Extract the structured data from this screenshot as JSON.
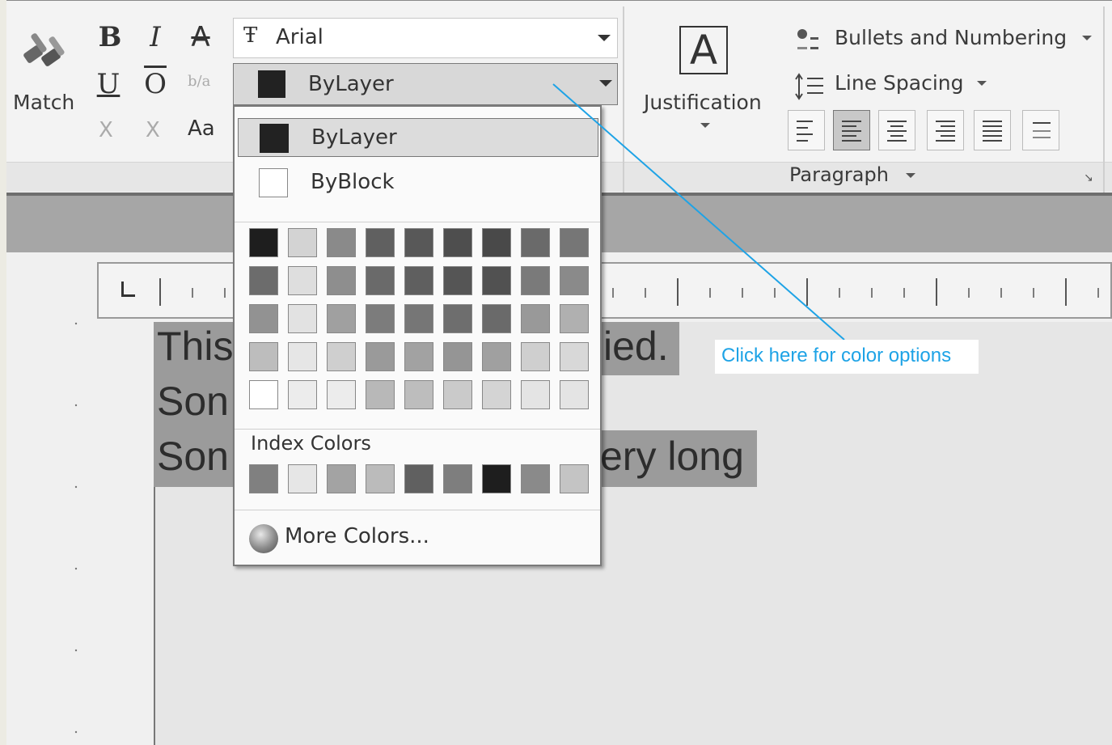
{
  "ribbon": {
    "match_label": "Match",
    "bold": "B",
    "italic": "I",
    "strike": "A",
    "underline": "U",
    "overline": "O",
    "stack": "b/a",
    "superscript": "X",
    "subscript": "X",
    "case": "Aa",
    "font_value": "Arial",
    "color_value": "ByLayer",
    "justification_label": "Justification",
    "bullets_label": "Bullets and Numbering",
    "line_spacing_label": "Line Spacing",
    "paragraph_label": "Paragraph"
  },
  "color_dropdown": {
    "items": [
      {
        "label": "ByLayer",
        "color": "#222222",
        "selected": true
      },
      {
        "label": "ByBlock",
        "color": "#ffffff",
        "selected": false
      }
    ],
    "palette": [
      [
        "#1e1e1e",
        "#d3d3d3",
        "#8a8a8a",
        "#606060",
        "#585858",
        "#4e4e4e",
        "#494949",
        "#6a6a6a",
        "#767676"
      ],
      [
        "#6c6c6c",
        "#dedede",
        "#8e8e8e",
        "#6a6a6a",
        "#5f5f5f",
        "#555555",
        "#515151",
        "#7a7a7a",
        "#8a8a8a"
      ],
      [
        "#929292",
        "#e2e2e2",
        "#a0a0a0",
        "#7c7c7c",
        "#767676",
        "#6e6e6e",
        "#6a6a6a",
        "#999999",
        "#b0b0b0"
      ],
      [
        "#bdbdbd",
        "#e6e6e6",
        "#cfcfcf",
        "#9a9a9a",
        "#a2a2a2",
        "#959595",
        "#a0a0a0",
        "#cfcfcf",
        "#d8d8d8"
      ],
      [
        "#ffffff",
        "#ececec",
        "#ececec",
        "#b8b8b8",
        "#bdbdbd",
        "#cacaca",
        "#d4d4d4",
        "#e4e4e4",
        "#e4e4e4"
      ]
    ],
    "index_colors_label": "Index Colors",
    "index_colors": [
      "#808080",
      "#e6e6e6",
      "#a3a3a3",
      "#bbbbbb",
      "#606060",
      "#7e7e7e",
      "#1e1e1e",
      "#8a8a8a",
      "#c4c4c4"
    ],
    "more_colors_label": "More Colors..."
  },
  "document": {
    "line1_left": "This",
    "line1_right": "ied.",
    "line2_left": "Son",
    "line3_left": "Son",
    "line3_right": "ery long"
  },
  "callout": {
    "text": "Click here for color options",
    "color": "#1ea3e6"
  }
}
